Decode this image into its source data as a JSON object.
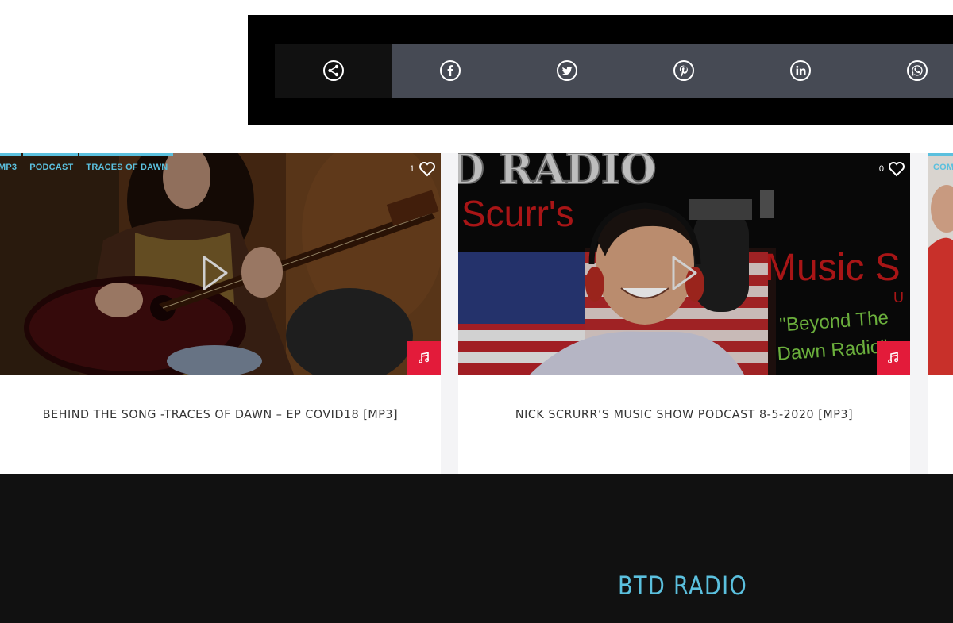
{
  "share": {
    "buttons": [
      {
        "icon": "share-icon"
      },
      {
        "icon": "facebook-icon"
      },
      {
        "icon": "twitter-icon"
      },
      {
        "icon": "pinterest-icon"
      },
      {
        "icon": "linkedin-icon"
      },
      {
        "icon": "whatsapp-icon"
      }
    ]
  },
  "cards": [
    {
      "tags": [
        "MP3",
        "PODCAST",
        "TRACES OF DAWN"
      ],
      "likes": "1",
      "title": "BEHIND THE SONG -TRACES OF DAWN – EP COVID18 [MP3]"
    },
    {
      "likes": "0",
      "image_text": [
        "D RADIO",
        "Scurr's",
        "Music S",
        "U",
        "\"Beyond The",
        "Dawn Radio\""
      ],
      "title": "NICK SCRURR’S MUSIC SHOW PODCAST 8-5-2020 [MP3]"
    },
    {
      "tags": [
        "COM"
      ]
    }
  ],
  "footer": {
    "title": "BTD RADIO"
  },
  "colors": {
    "accent": "#5bc0de",
    "badge": "#e31b3a",
    "footer_bg": "#111111",
    "share_bar": "#464a54"
  }
}
